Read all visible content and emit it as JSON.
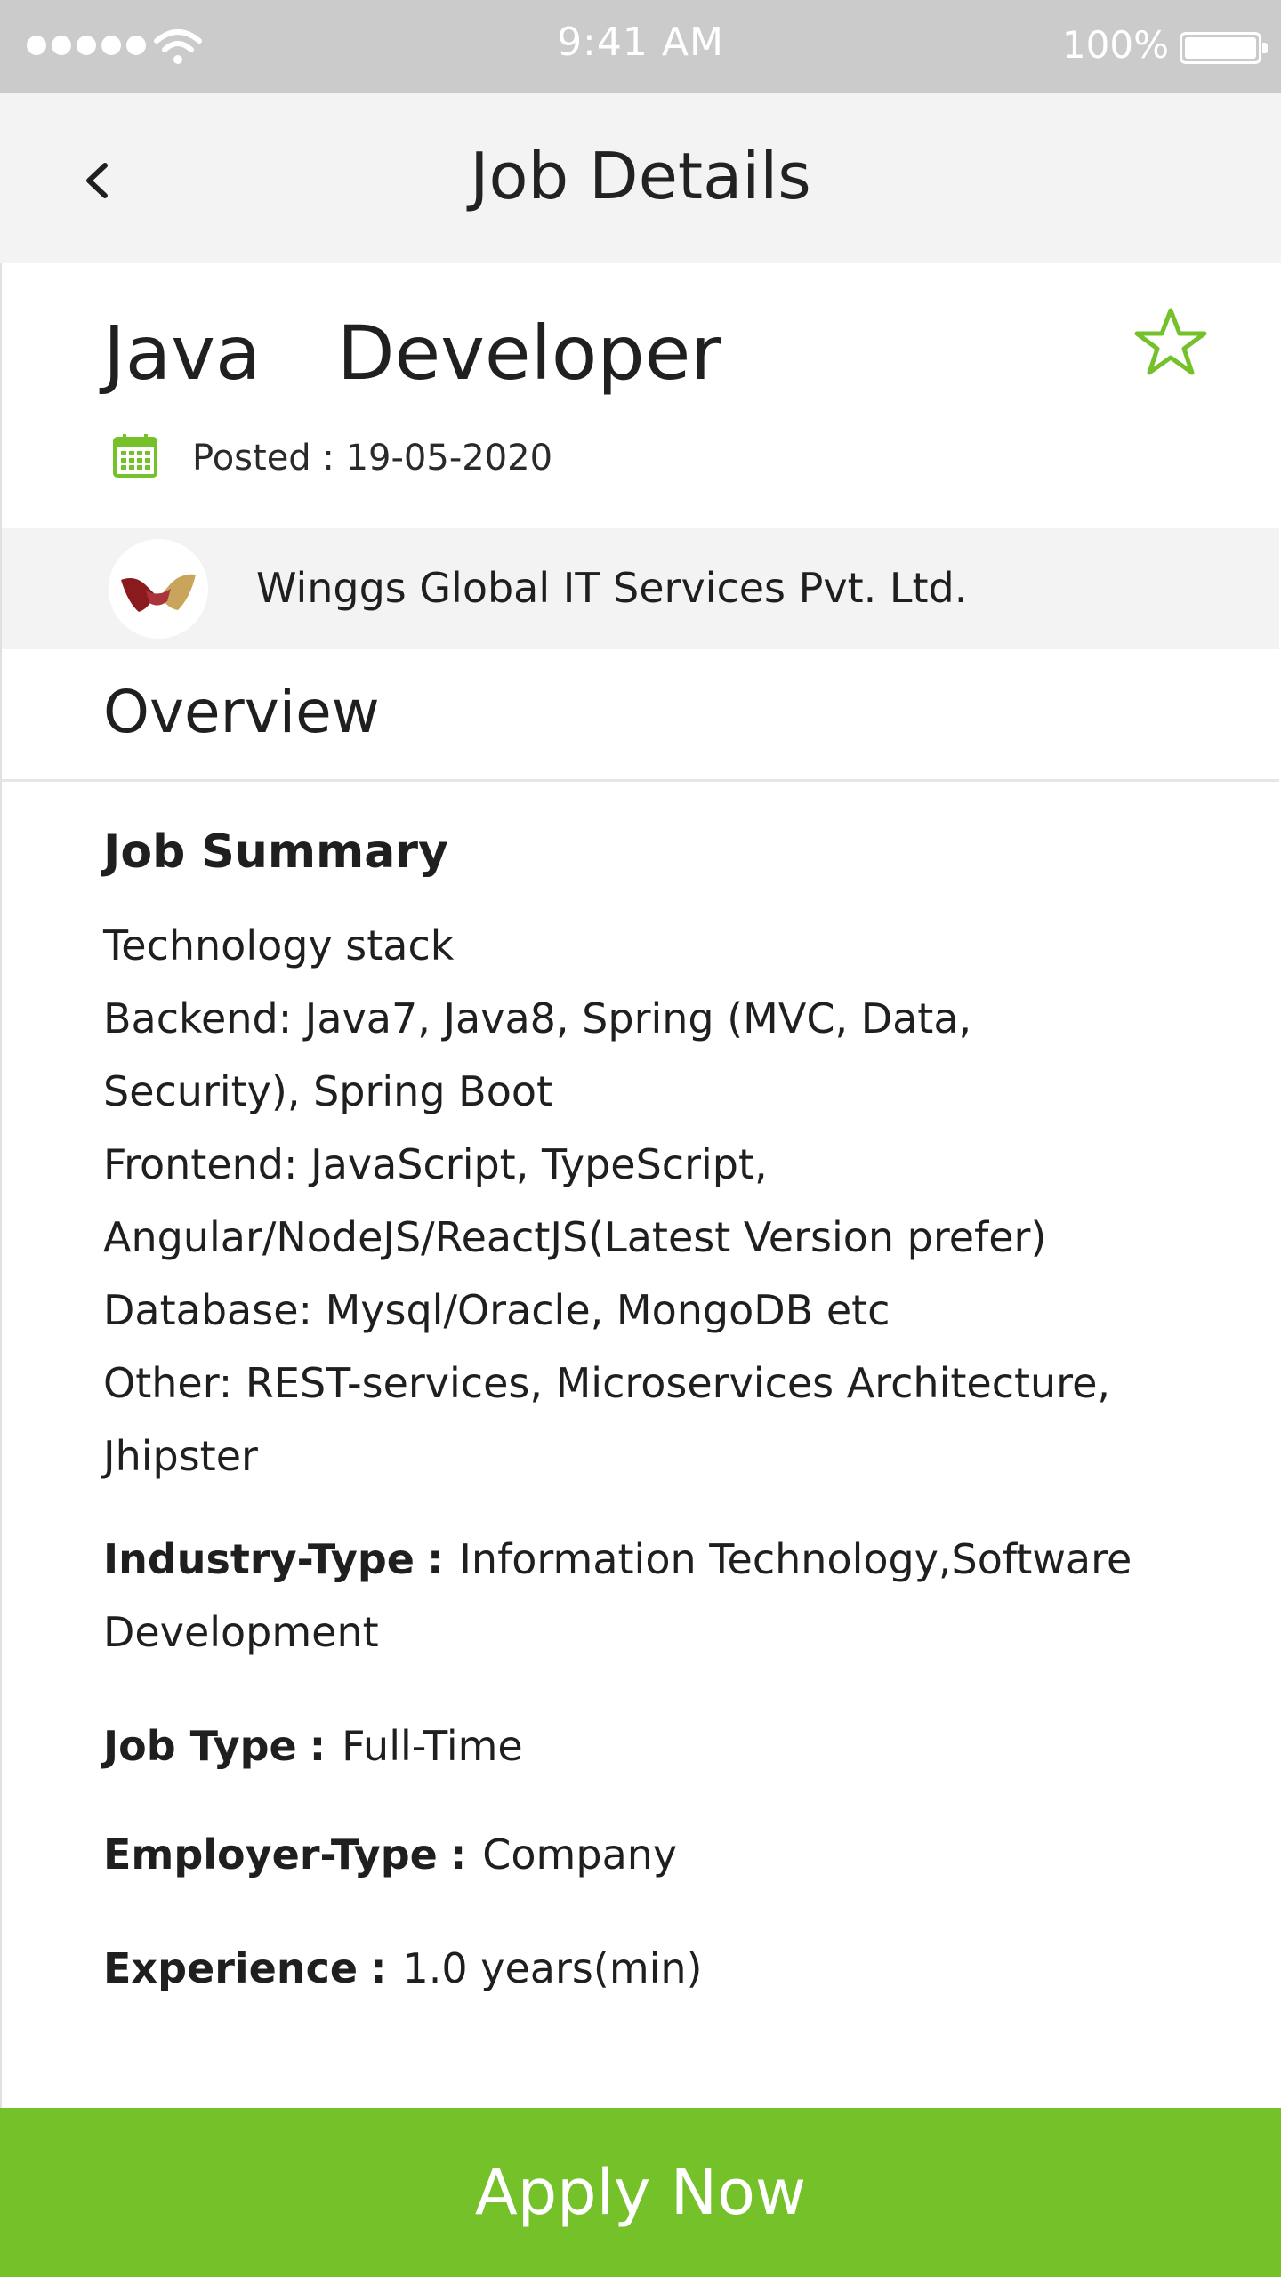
{
  "status_bar": {
    "time": "9:41 AM",
    "battery": "100%"
  },
  "nav": {
    "title": "Job Details",
    "back_icon": "chevron-left-icon"
  },
  "job": {
    "title": "Java  Developer",
    "posted": "Posted : 19-05-2020",
    "favorite_icon": "star-outline-icon"
  },
  "company": {
    "name": "Winggs Global IT Services Pvt. Ltd."
  },
  "overview": {
    "heading": "Overview"
  },
  "summary": {
    "heading": "Job Summary",
    "lines": [
      "Technology stack",
      "Backend: Java7, Java8, Spring (MVC, Data,",
      "Security), Spring Boot",
      "Frontend: JavaScript, TypeScript,",
      "Angular/NodeJS/ReactJS(Latest Version prefer)",
      "Database: Mysql/Oracle, MongoDB etc",
      "Other: REST-services, Microservices Architecture,",
      "Jhipster"
    ]
  },
  "details": {
    "industry": {
      "label": "Industry-Type",
      "value_line1": "Information Technology,Software",
      "value_line2": "Development"
    },
    "job_type": {
      "label": "Job Type",
      "value": "Full-Time"
    },
    "employer_type": {
      "label": "Employer-Type",
      "value": "Company"
    },
    "experience": {
      "label": "Experience",
      "value": "1.0 years(min)"
    }
  },
  "separator": ":",
  "apply": {
    "label": "Apply Now"
  },
  "colors": {
    "accent": "#74c12a",
    "status_bar": "#cbcbcb",
    "nav_bg": "#f3f3f3"
  }
}
